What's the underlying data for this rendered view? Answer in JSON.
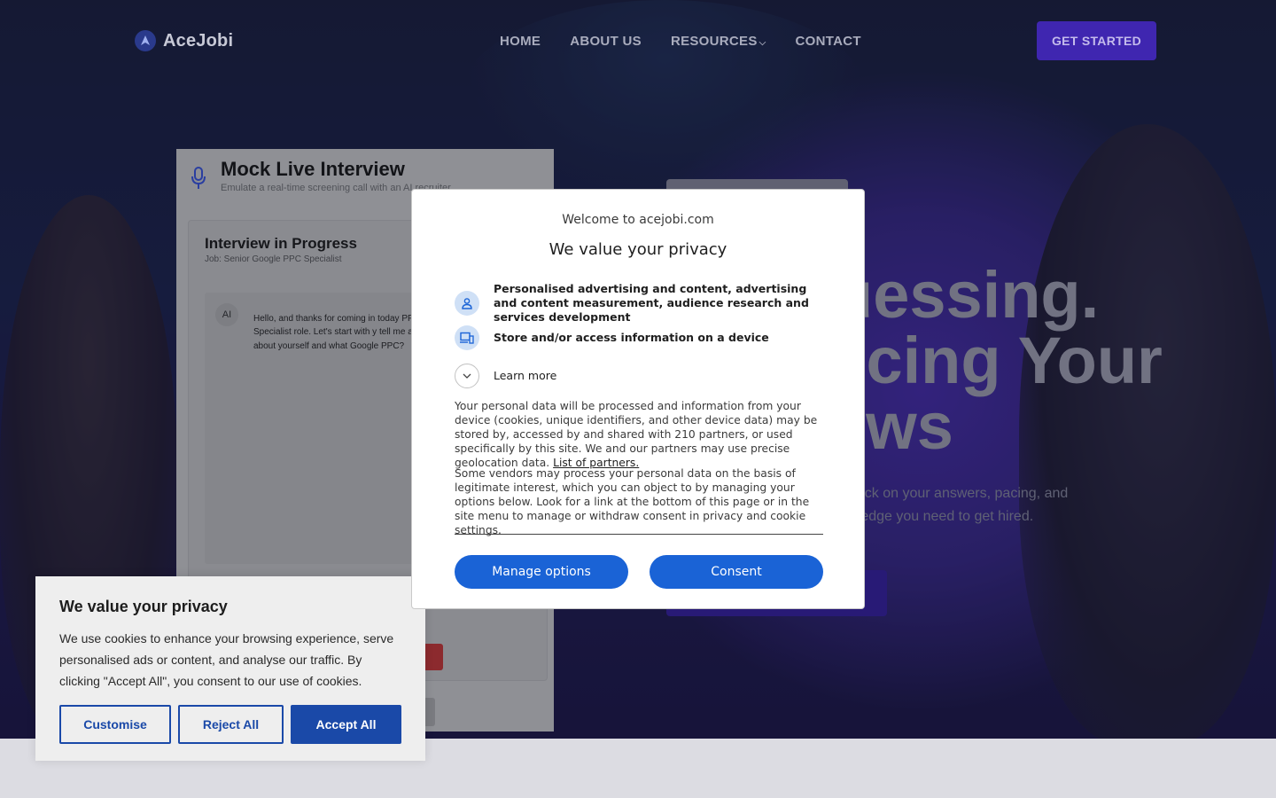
{
  "nav": {
    "logo_text": "AceJobi",
    "menu": [
      "HOME",
      "ABOUT US",
      "RESOURCES",
      "CONTACT"
    ],
    "cta": "GET STARTED"
  },
  "hero": {
    "headline": [
      "uessing.",
      "Acing Your",
      "ews"
    ],
    "sub": [
      "back on your answers, pacing, and",
      "e edge you need to get hired."
    ]
  },
  "mock": {
    "title": "Mock Live Interview",
    "subtitle": "Emulate a real-time screening call with an AI recruiter",
    "status_title": "Interview in Progress",
    "job": "Job: Senior Google PPC Specialist",
    "ai_badge": "AI",
    "ai_message": "Hello, and thanks for coming in today PPC Specialist role. Let's start with y tell me a bit about yourself and what Google PPC?"
  },
  "cookie_banner": {
    "title": "We value your privacy",
    "text": "We use cookies to enhance your browsing experience, serve personalised ads or content, and analyse our traffic. By clicking \"Accept All\", you consent to our use of cookies.",
    "customise": "Customise",
    "reject": "Reject All",
    "accept": "Accept All"
  },
  "consent_modal": {
    "welcome": "Welcome to acejobi.com",
    "title": "We value your privacy",
    "purpose_1": "Personalised advertising and content, advertising and content measurement, audience research and services development",
    "purpose_2": "Store and/or access information on a device",
    "learn_more": "Learn more",
    "para_1": "Your personal data will be processed and information from your device (cookies, unique identifiers, and other device data) may be stored by, accessed by and shared with 210 partners, or used specifically by this site. We and our partners may use precise geolocation data.",
    "partners_link": "List of partners.",
    "para_2": "Some vendors may process your personal data on the basis of legitimate interest, which you can object to by managing your options below. Look for a link at the bottom of this page or in the site menu to manage or withdraw consent in privacy and cookie settings.",
    "manage": "Manage options",
    "consent": "Consent"
  },
  "colors": {
    "brand_purple": "#3f26b0",
    "consent_blue": "#1a63d6",
    "cookie_blue": "#1a49a8"
  }
}
